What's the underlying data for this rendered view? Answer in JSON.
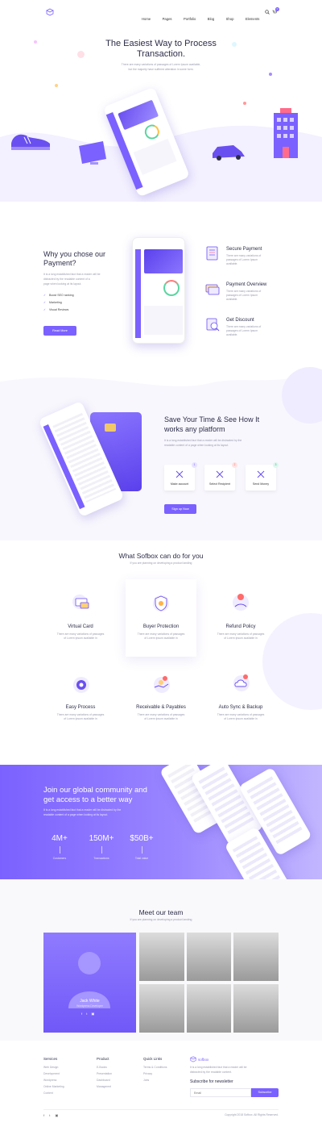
{
  "header": {
    "nav": [
      "Home",
      "Pages",
      "Portfolio",
      "Blog",
      "Shop",
      "Elements"
    ],
    "cart_count": "0"
  },
  "hero": {
    "title_line1": "The Easiest Way to Process",
    "title_line2": "Transaction.",
    "subtitle_line1": "There are many variations of passages of Lorem Ipsum available,",
    "subtitle_line2": "but the majority have suffered alteration in some form."
  },
  "why": {
    "title_line1": "Why you chose our",
    "title_line2": "Payment?",
    "text_line1": "It is a long established fact that a reader will be",
    "text_line2": "distracted by the readable content of a",
    "text_line3": "page when looking at its layout.",
    "checklist": [
      "Boost SEO ranking",
      "Marketing",
      "Visual Reviews"
    ],
    "button": "Read More",
    "features": [
      {
        "title": "Secure Payment",
        "l1": "There are many variations of",
        "l2": "passages of Lorem Ipsum",
        "l3": "available."
      },
      {
        "title": "Payment Overview",
        "l1": "There are many variations of",
        "l2": "passages of Lorem Ipsum",
        "l3": "available."
      },
      {
        "title": "Get Discount",
        "l1": "There are many variations of",
        "l2": "passages of Lorem Ipsum",
        "l3": "available."
      }
    ]
  },
  "save": {
    "title_line1": "Save Your Time & See How It",
    "title_line2": "works any platform",
    "text_line1": "It is a long established fact that a reader will be distracted by the",
    "text_line2": "readable content of a page when looking at its layout.",
    "steps": [
      {
        "num": "1",
        "label": "Make account"
      },
      {
        "num": "2",
        "label": "Select Recipient"
      },
      {
        "num": "3",
        "label": "Send Money"
      }
    ],
    "button": "Sign up Now"
  },
  "services": {
    "title": "What Sofbox can do for you",
    "subtitle": "If you are planning on developing a product landing",
    "items": [
      {
        "title": "Virtual Card",
        "l1": "There are many variations of passages",
        "l2": "of Lorem Ipsum available in"
      },
      {
        "title": "Buyer Protection",
        "l1": "There are many variations of passages",
        "l2": "of Lorem Ipsum available in"
      },
      {
        "title": "Refund Policy",
        "l1": "There are many variations of passages",
        "l2": "of Lorem Ipsum available in"
      },
      {
        "title": "Easy Process",
        "l1": "There are many variations of passages",
        "l2": "of Lorem Ipsum available in"
      },
      {
        "title": "Receivable & Payables",
        "l1": "There are many variations of passages",
        "l2": "of Lorem Ipsum available in"
      },
      {
        "title": "Auto Sync & Backup",
        "l1": "There are many variations of passages",
        "l2": "of Lorem Ipsum available in"
      }
    ]
  },
  "community": {
    "title_line1": "Join our global community and",
    "title_line2": "get access to a better way",
    "text_line1": "It is a long established fact that a reader will be distracted by the",
    "text_line2": "readable content of a page when looking at its layout.",
    "stats": [
      {
        "value": "4M+",
        "label": "Customers"
      },
      {
        "value": "150M+",
        "label": "Transactions"
      },
      {
        "value": "$50B+",
        "label": "Total value"
      }
    ]
  },
  "team": {
    "title": "Meet our team",
    "subtitle": "If you are planning on developing a product landing",
    "featured_name": "Jack White",
    "featured_role": "Wordpress Developer"
  },
  "footer": {
    "columns": [
      {
        "title": "Services",
        "links": [
          "Web Design",
          "Development",
          "Wordpress",
          "Online Marketing",
          "Content"
        ]
      },
      {
        "title": "Product",
        "links": [
          "E-Books",
          "Presentation",
          "Dashboard",
          "Managment"
        ]
      },
      {
        "title": "Quick Links",
        "links": [
          "Terms & Conditions",
          "Privacy",
          "Jobs"
        ]
      }
    ],
    "brand": "sofbox",
    "about_line1": "It is a long established fact that a reader will be",
    "about_line2": "distracted by the readable content.",
    "newsletter_title": "Subscribe for newsletter",
    "email_placeholder": "Email",
    "subscribe": "Subscribe",
    "copyright": "Copyright 2018 Sofbox. All Rights Reserved."
  },
  "colors": {
    "accent": "#7b61ff",
    "accent_dark": "#6a4ff0",
    "text": "#2d2d4a"
  }
}
